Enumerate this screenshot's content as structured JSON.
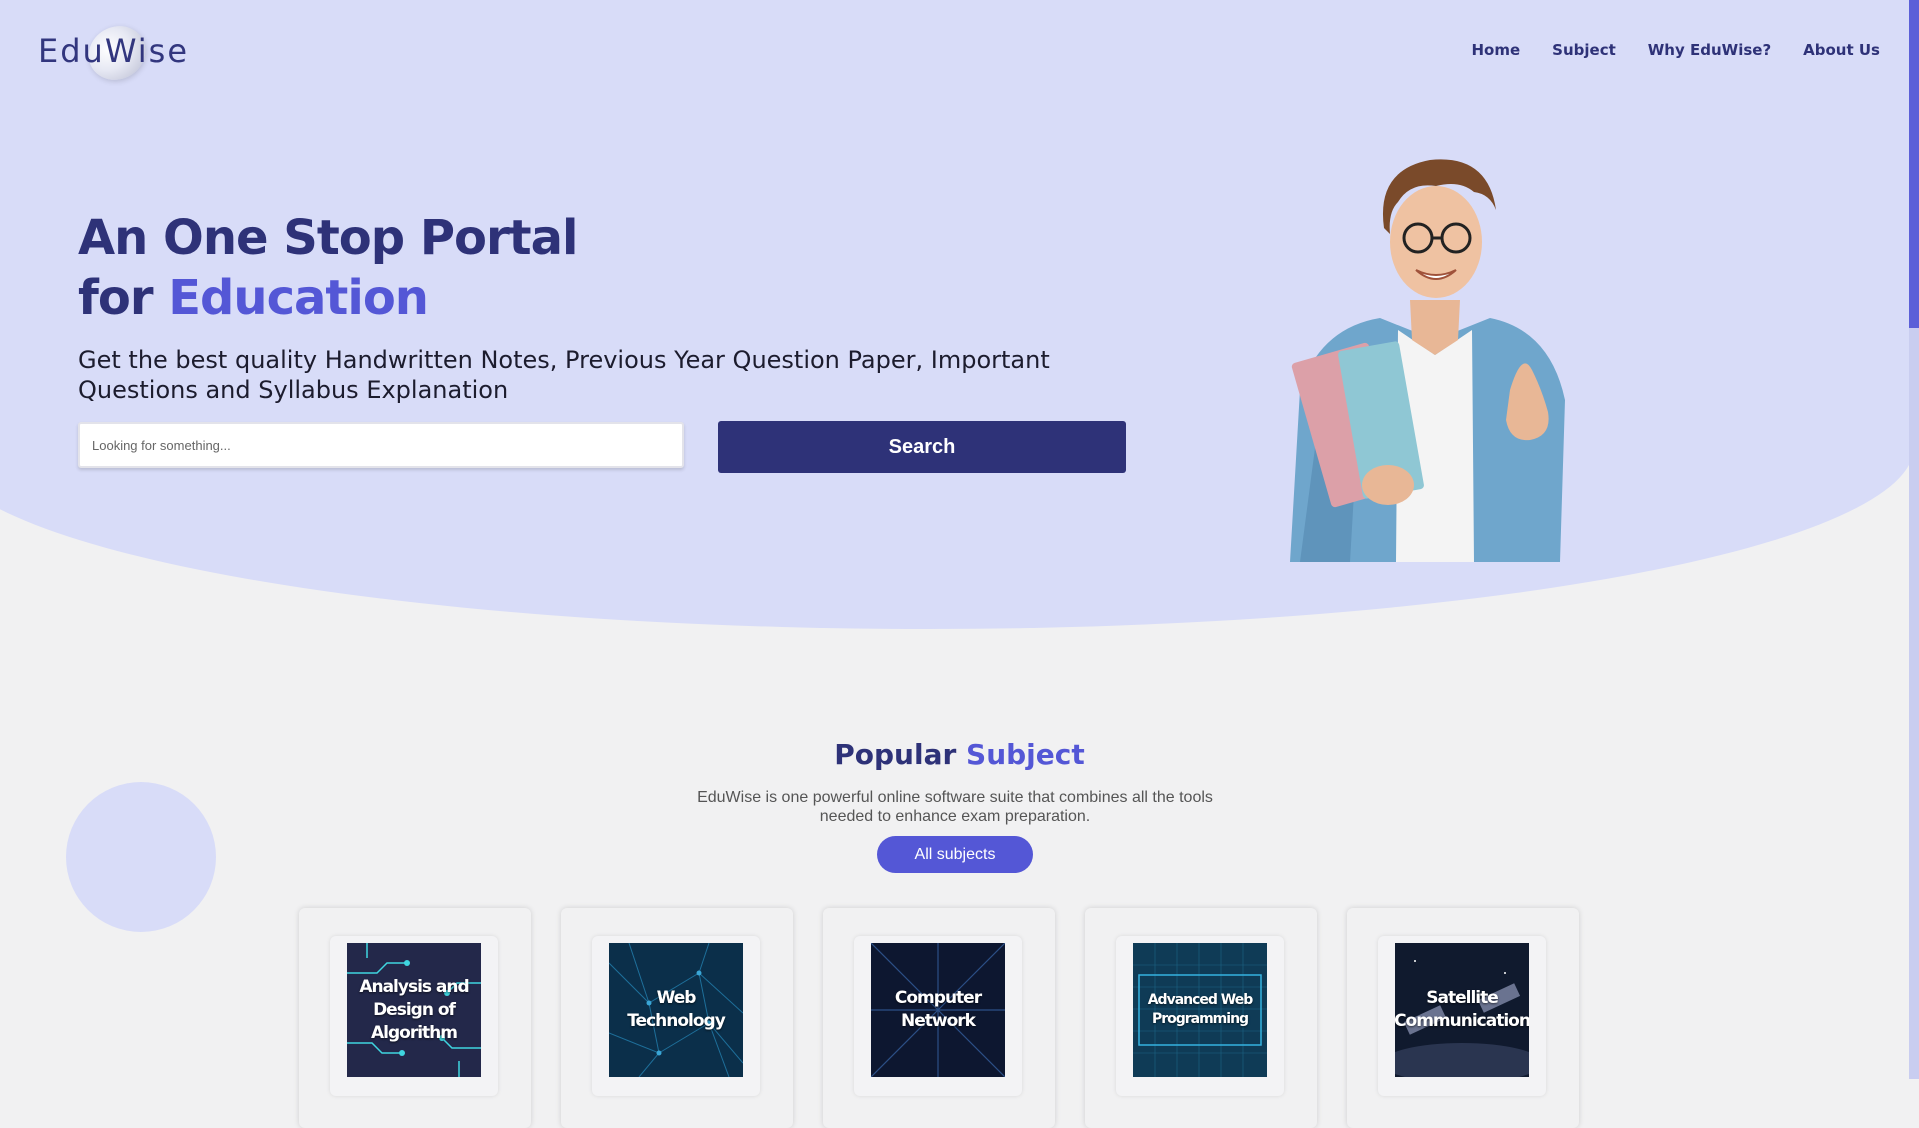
{
  "brand": {
    "name": "EduWise"
  },
  "nav": {
    "items": [
      "Home",
      "Subject",
      "Why EduWise?",
      "About Us"
    ]
  },
  "hero": {
    "title_line1": "An One Stop Portal",
    "title_for": "for ",
    "title_accent": "Education",
    "subtitle": "Get the best quality Handwritten Notes, Previous Year Question Paper, Important Questions and Syllabus Explanation",
    "search_placeholder": "Looking for something...",
    "search_button": "Search"
  },
  "popular": {
    "title_word": "Popular",
    "title_accent": "Subject",
    "description": "EduWise is one powerful online software suite that combines all the tools needed to enhance exam preparation.",
    "all_button": "All subjects"
  },
  "subjects": [
    {
      "label": "Analysis and Design of Algorithm",
      "icon": "circuit-board",
      "color": "#23284a"
    },
    {
      "label": "Web Technology",
      "icon": "network-mesh",
      "color": "#0b2f4a"
    },
    {
      "label": "Computer Network",
      "icon": "binary-tunnel",
      "color": "#0d1730"
    },
    {
      "label": "Advanced Web Programming",
      "icon": "tech-frame",
      "color": "#0f3b56"
    },
    {
      "label": "Satellite Communication",
      "icon": "satellite",
      "color": "#101a2e"
    }
  ],
  "colors": {
    "primary": "#2e3278",
    "accent": "#5457d6",
    "hero_bg": "#d8dcf8",
    "page_bg": "#f1f1f2"
  }
}
